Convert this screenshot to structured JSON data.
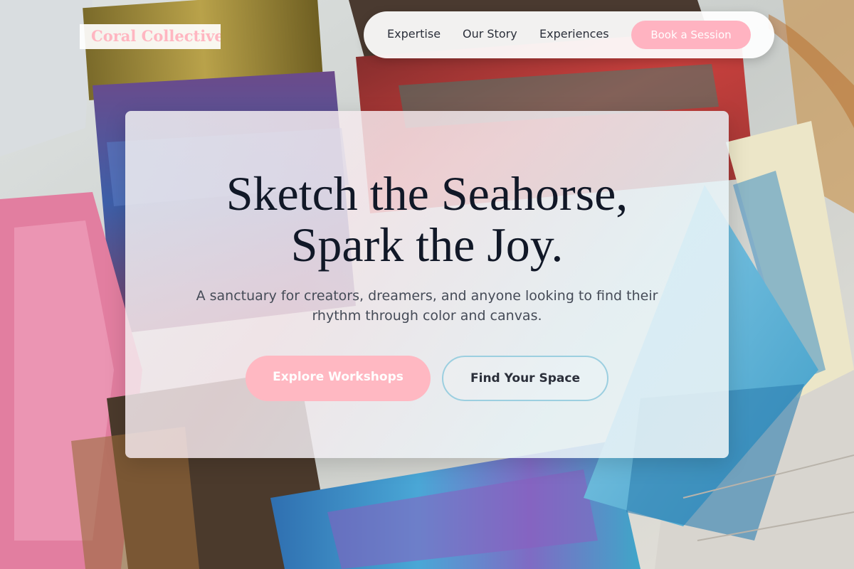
{
  "brand": {
    "name": "Coral Collective",
    "color": "#ffb6c1"
  },
  "nav": {
    "links": [
      {
        "label": "Expertise"
      },
      {
        "label": "Our Story"
      },
      {
        "label": "Experiences"
      }
    ],
    "cta_label": "Book a Session"
  },
  "hero": {
    "title_line1": "Sketch the Seahorse,",
    "title_line2": "Spark the Joy.",
    "subtitle": "A sanctuary for creators, dreamers, and anyone looking to find their rhythm through color and canvas.",
    "primary_button": "Explore Workshops",
    "secondary_button": "Find Your Space"
  },
  "colors": {
    "accent_pink": "#ffb3c1",
    "accent_blue_border": "#9ccfe0",
    "title_text": "#111827",
    "body_text": "#454b57"
  },
  "background": {
    "subject": "paintbrushes-photo"
  }
}
